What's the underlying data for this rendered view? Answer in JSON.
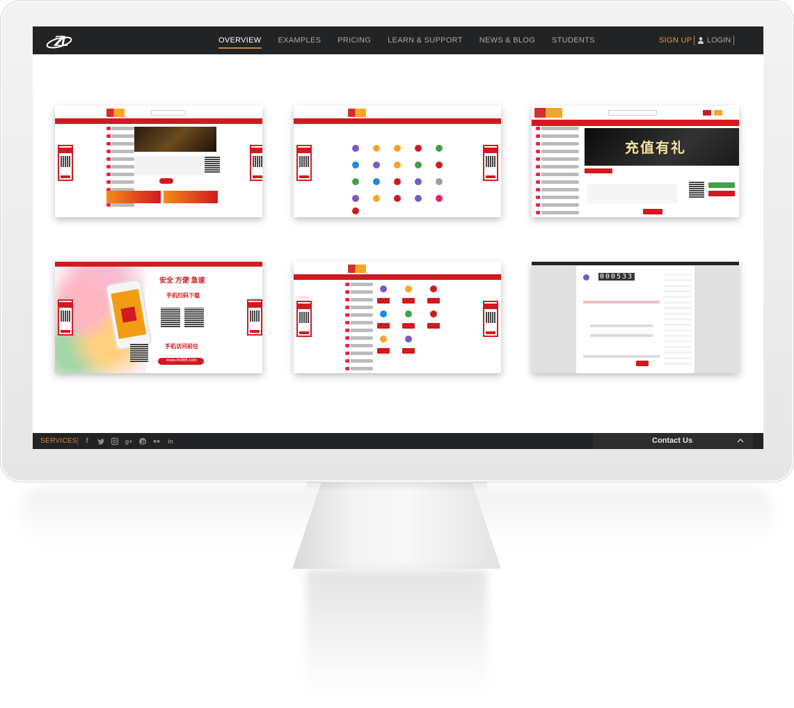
{
  "nav": {
    "logo_alt": "ZL",
    "items": [
      {
        "label": "OVERVIEW",
        "active": true
      },
      {
        "label": "EXAMPLES",
        "active": false
      },
      {
        "label": "PRICING",
        "active": false
      },
      {
        "label": "LEARN & SUPPORT",
        "active": false
      },
      {
        "label": "NEWS & BLOG",
        "active": false
      },
      {
        "label": "STUDENTS",
        "active": false
      }
    ],
    "signup": "SIGN UP",
    "login": "LOGIN"
  },
  "thumbnails": {
    "t4": {
      "headline": "安全 方便 急速",
      "scan_label": "手机扫码下载",
      "visit_label": "手机访问前往",
      "url": "www.lm966.com"
    },
    "t3": {
      "banner": "充值有礼"
    },
    "t6": {
      "counter": "000533"
    }
  },
  "footer": {
    "services": "SERVICES",
    "socials": [
      "facebook-icon",
      "twitter-icon",
      "instagram-icon",
      "google-plus-icon",
      "pinterest-icon",
      "flickr-icon",
      "linkedin-icon"
    ],
    "contact": "Contact Us"
  },
  "colors": {
    "nav_bg": "#222324",
    "accent": "#c8853a",
    "signup": "#e8963a",
    "brand_red": "#d2191f"
  }
}
